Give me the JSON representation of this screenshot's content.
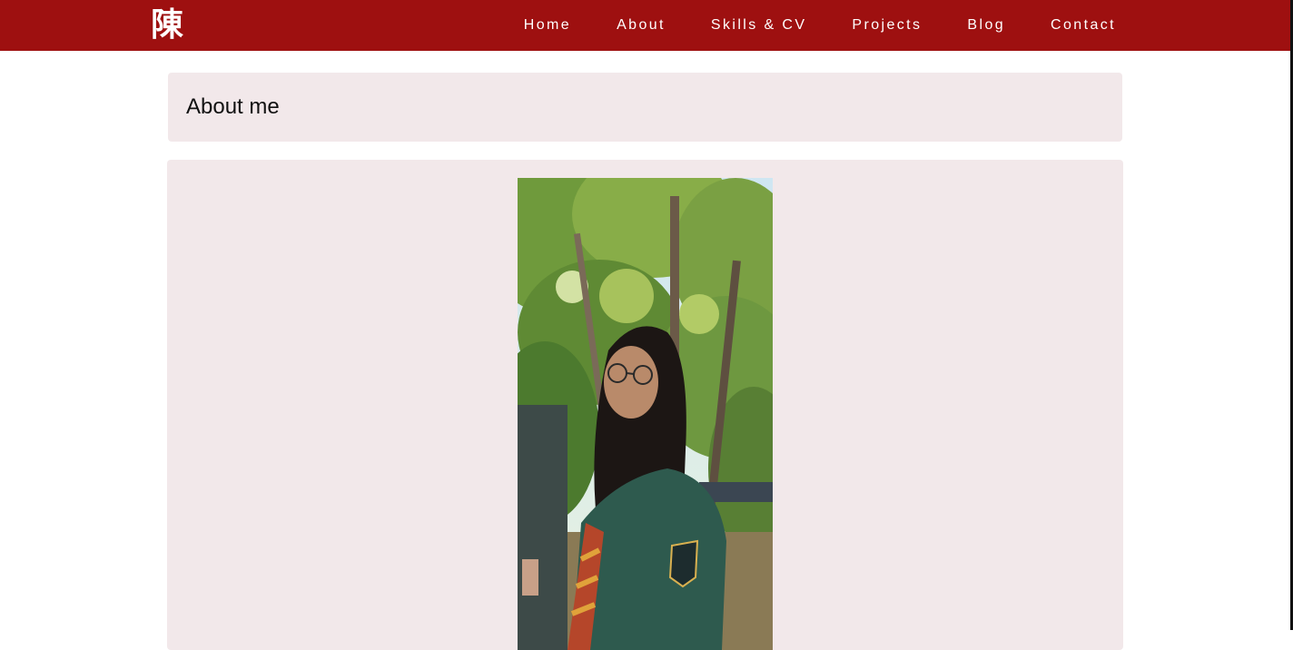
{
  "nav": {
    "brand": "陳",
    "links": [
      "Home",
      "About",
      "Skills & CV",
      "Projects",
      "Blog",
      "Contact"
    ]
  },
  "main": {
    "title": "About me",
    "photo": {
      "subject_icon": "portrait-photo"
    }
  },
  "colors": {
    "navbar": "#9e1010",
    "card": "#f2e8ea",
    "text": "#111111"
  }
}
